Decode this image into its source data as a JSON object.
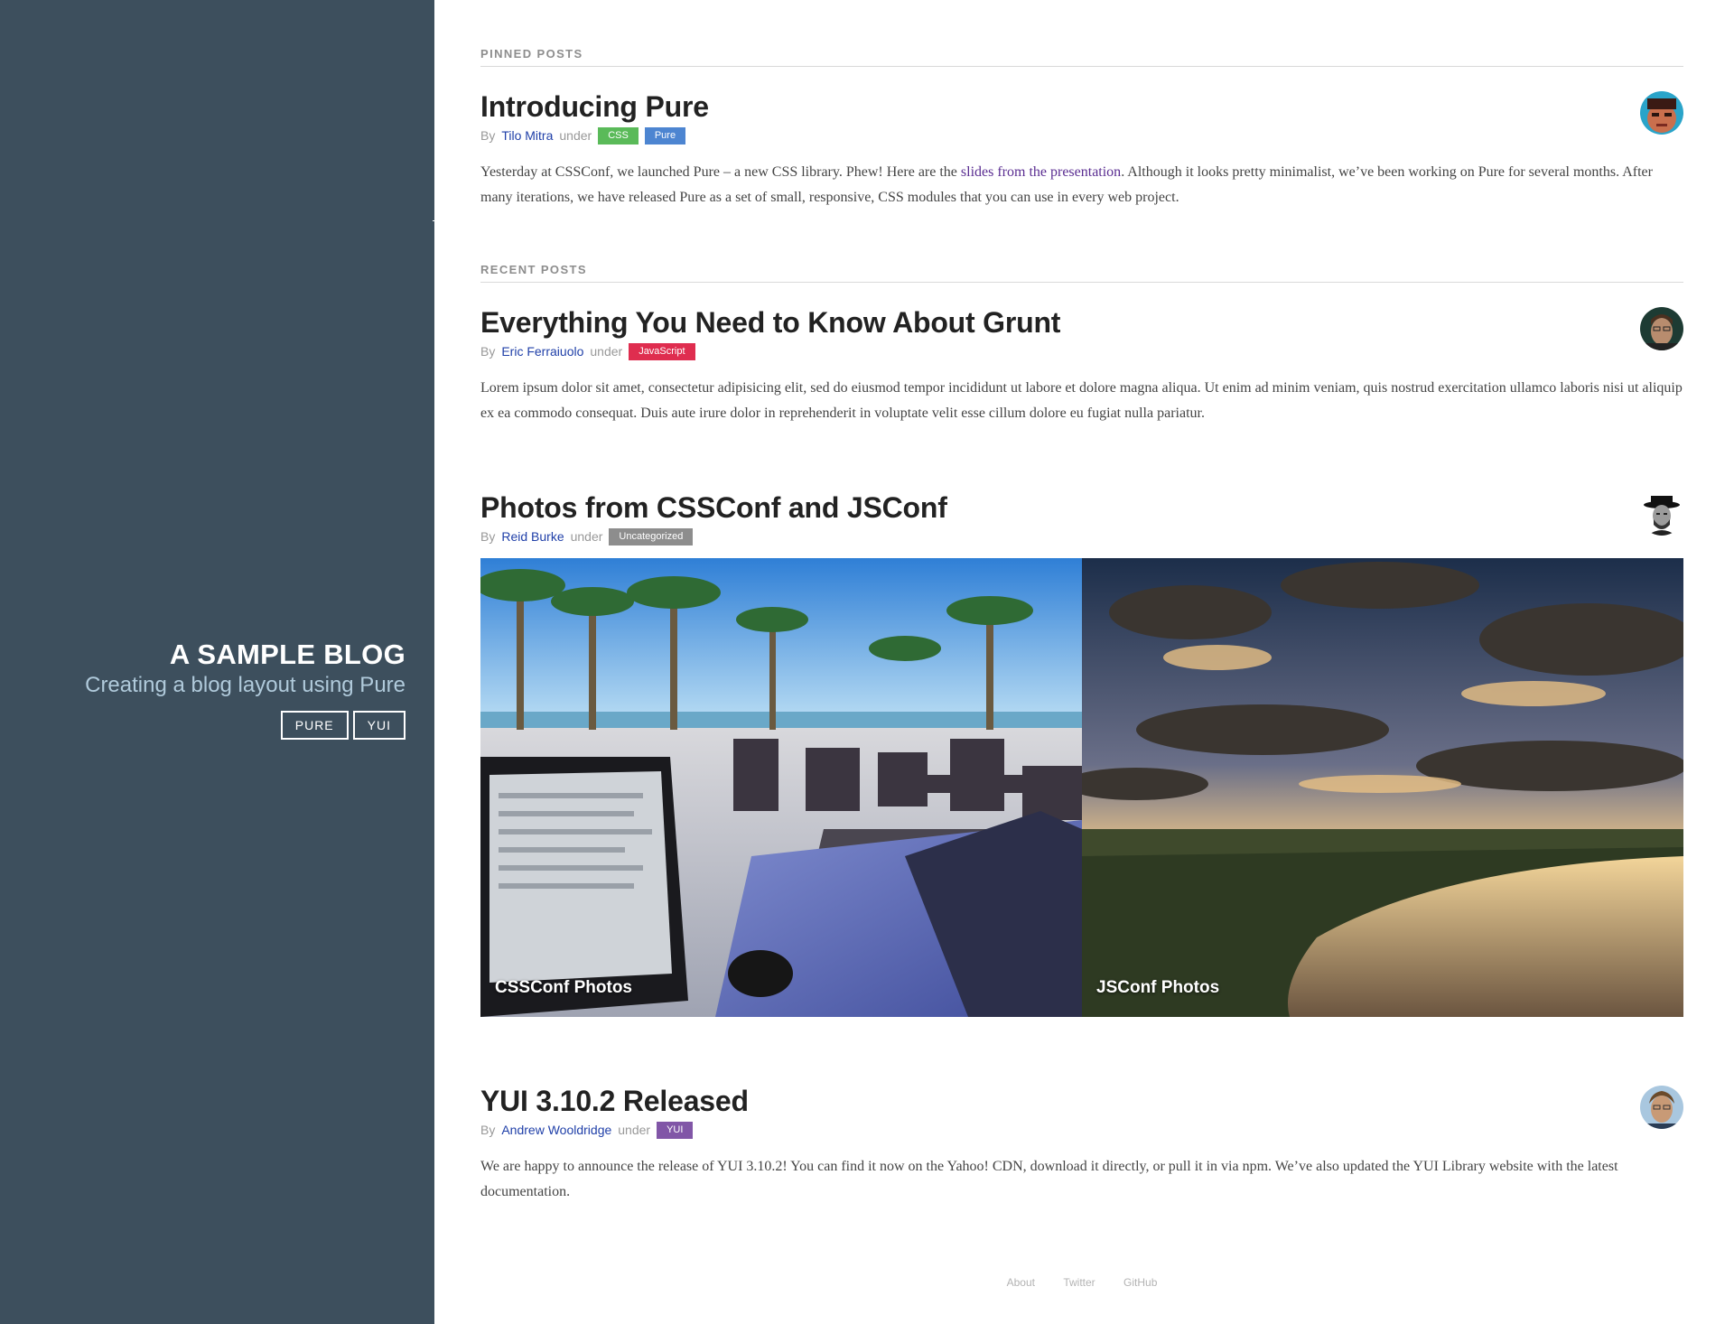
{
  "sidebar": {
    "title": "A SAMPLE BLOG",
    "tagline": "Creating a blog layout using Pure",
    "nav": [
      {
        "label": "PURE"
      },
      {
        "label": "YUI"
      }
    ]
  },
  "sections": {
    "pinned": "PINNED POSTS",
    "recent": "RECENT POSTS"
  },
  "posts": [
    {
      "title": "Introducing Pure",
      "by": "By",
      "author": "Tilo Mitra",
      "under": "under",
      "tags": [
        "CSS",
        "Pure"
      ],
      "body_before": "Yesterday at CSSConf, we launched Pure – a new CSS library. Phew! Here are the ",
      "body_link": "slides from the presentation",
      "body_after": ". Although it looks pretty minimalist, we’ve been working on Pure for several months. After many iterations, we have released Pure as a set of small, responsive, CSS modules that you can use in every web project."
    },
    {
      "title": "Everything You Need to Know About Grunt",
      "by": "By",
      "author": "Eric Ferraiuolo",
      "under": "under",
      "tags": [
        "JavaScript"
      ],
      "body": "Lorem ipsum dolor sit amet, consectetur adipisicing elit, sed do eiusmod tempor incididunt ut labore et dolore magna aliqua. Ut enim ad minim veniam, quis nostrud exercitation ullamco laboris nisi ut aliquip ex ea commodo consequat. Duis aute irure dolor in reprehenderit in voluptate velit esse cillum dolore eu fugiat nulla pariatur."
    },
    {
      "title": "Photos from CSSConf and JSConf",
      "by": "By",
      "author": "Reid Burke",
      "under": "under",
      "tags": [
        "Uncategorized"
      ],
      "photos": [
        {
          "caption": "CSSConf Photos"
        },
        {
          "caption": "JSConf Photos"
        }
      ]
    },
    {
      "title": "YUI 3.10.2 Released",
      "by": "By",
      "author": "Andrew Wooldridge",
      "under": "under",
      "tags": [
        "YUI"
      ],
      "body": "We are happy to announce the release of YUI 3.10.2! You can find it now on the Yahoo! CDN, download it directly, or pull it in via npm. We’ve also updated the YUI Library website with the latest documentation."
    }
  ],
  "footer": {
    "links": [
      "About",
      "Twitter",
      "GitHub"
    ]
  },
  "colors": {
    "sidebar_bg": "#3d4f5d",
    "tag_css": "#5aba59",
    "tag_pure": "#4d85d1",
    "tag_javascript": "#df2d4f",
    "tag_uncategorized": "#8d8d8d",
    "tag_yui": "#8156a7",
    "author_link": "#1f3fa8"
  }
}
